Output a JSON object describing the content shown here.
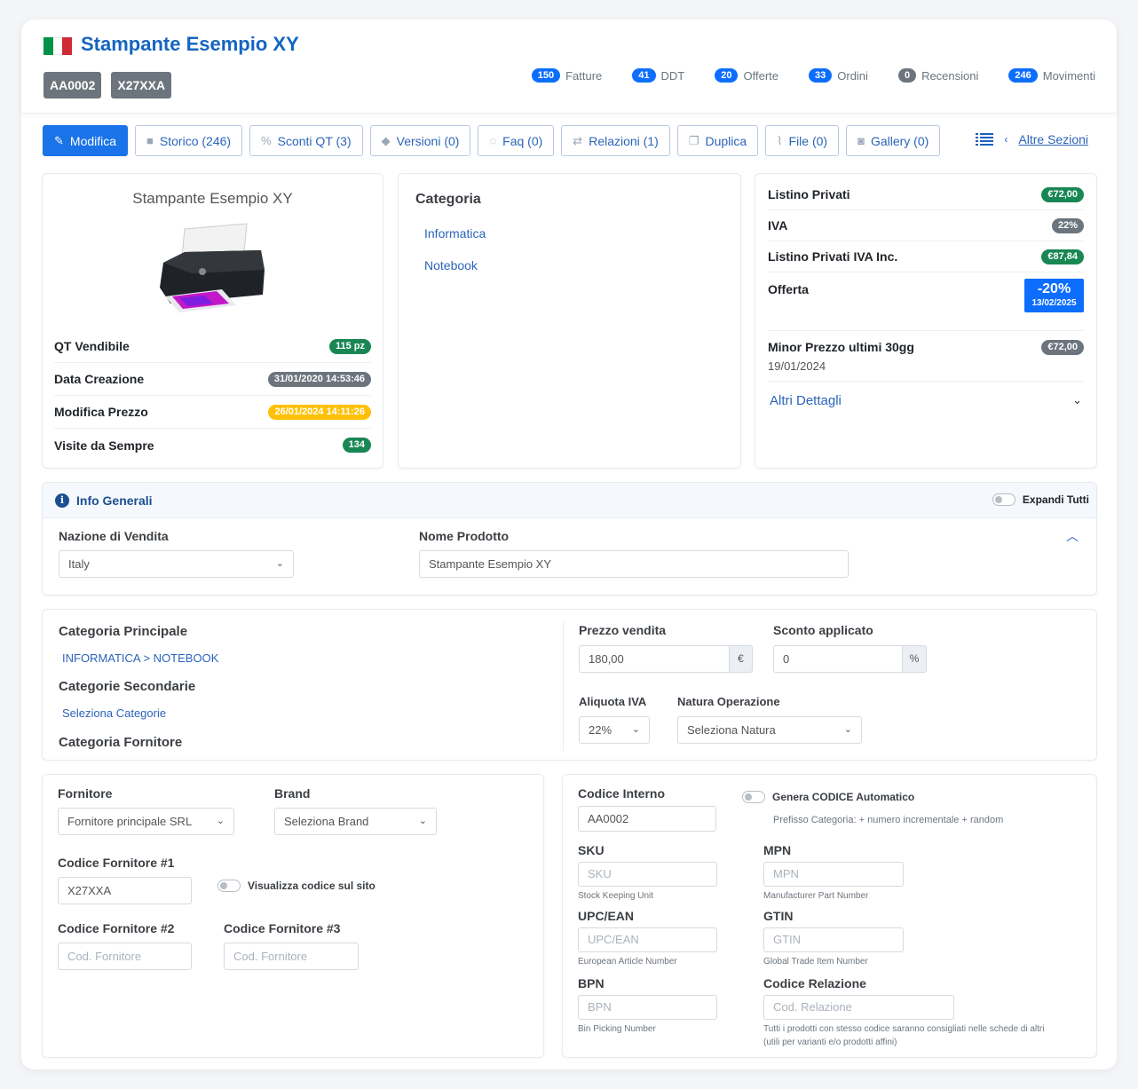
{
  "product": {
    "title": "Stampante Esempio XY",
    "codes": [
      "AA0002",
      "X27XXA"
    ]
  },
  "stats": [
    {
      "count": "150",
      "label": "Fatture",
      "color": "#0d6efd"
    },
    {
      "count": "41",
      "label": "DDT",
      "color": "#0d6efd"
    },
    {
      "count": "20",
      "label": "Offerte",
      "color": "#0d6efd"
    },
    {
      "count": "33",
      "label": "Ordini",
      "color": "#0d6efd"
    },
    {
      "count": "0",
      "label": "Recensioni",
      "color": "#6c757d"
    },
    {
      "count": "246",
      "label": "Movimenti",
      "color": "#0d6efd"
    }
  ],
  "toolbar": {
    "buttons": [
      {
        "label": "Modifica",
        "icon": "pencil-icon"
      },
      {
        "label": "Storico (246)",
        "icon": "history-icon"
      },
      {
        "label": "Sconti QT (3)",
        "icon": "percent-icon"
      },
      {
        "label": "Versioni (0)",
        "icon": "tag-icon"
      },
      {
        "label": "Faq (0)",
        "icon": "chat-icon"
      },
      {
        "label": "Relazioni (1)",
        "icon": "exchange-icon"
      },
      {
        "label": "Duplica",
        "icon": "copy-icon"
      },
      {
        "label": "File (0)",
        "icon": "paperclip-icon"
      },
      {
        "label": "Gallery (0)",
        "icon": "camera-icon"
      }
    ],
    "sections_link": "Altre Sezioni"
  },
  "summary": {
    "name": "Stampante Esempio XY",
    "rows": [
      {
        "label": "QT Vendibile",
        "value": "115 pz"
      },
      {
        "label": "Data Creazione",
        "value": "31/01/2020 14:53:46"
      },
      {
        "label": "Modifica Prezzo",
        "value": "26/01/2024 14:11:26"
      },
      {
        "label": "Visite da Sempre",
        "value": "134"
      }
    ]
  },
  "categoria": {
    "title": "Categoria",
    "items": [
      "Informatica",
      "Notebook"
    ]
  },
  "prices": {
    "listino_label": "Listino Privati",
    "listino_value": "€72,00",
    "iva_label": "IVA",
    "iva_value": "22%",
    "listino_iva_label": "Listino Privati IVA Inc.",
    "listino_iva_value": "€87,84",
    "offerta_label": "Offerta",
    "offerta_percent": "-20%",
    "offerta_date": "13/02/2025",
    "minor_label": "Minor Prezzo ultimi 30gg",
    "minor_date": "19/01/2024",
    "minor_value": "€72,00",
    "altri_dettagli": "Altri Dettagli"
  },
  "info_generali": {
    "title": "Info Generali",
    "expand_label": "Expandi Tutti",
    "nazione_label": "Nazione di Vendita",
    "nazione_value": "Italy",
    "nome_label": "Nome Prodotto",
    "nome_value": "Stampante Esempio XY"
  },
  "categories_panel": {
    "principale_label": "Categoria Principale",
    "principale_value": "INFORMATICA > NOTEBOOK",
    "secondarie_label": "Categorie Secondarie",
    "secondarie_link": "Seleziona Categorie",
    "fornitore_label": "Categoria Fornitore",
    "prezzo_label": "Prezzo vendita",
    "prezzo_value": "180,00",
    "prezzo_unit": "€",
    "sconto_label": "Sconto applicato",
    "sconto_value": "0",
    "sconto_unit": "%",
    "aliquota_label": "Aliquota IVA",
    "aliquota_value": "22%",
    "natura_label": "Natura Operazione",
    "natura_value": "Seleziona Natura"
  },
  "supplier": {
    "fornitore_label": "Fornitore",
    "fornitore_value": "Fornitore principale SRL",
    "brand_label": "Brand",
    "brand_value": "Seleziona Brand",
    "cod1_label": "Codice Fornitore #1",
    "cod1_value": "X27XXA",
    "visualizza_label": "Visualizza codice sul sito",
    "cod2_label": "Codice Fornitore #2",
    "cod2_placeholder": "Cod. Fornitore",
    "cod3_label": "Codice Fornitore #3",
    "cod3_placeholder": "Cod. Fornitore"
  },
  "codes_panel": {
    "interno_label": "Codice Interno",
    "interno_value": "AA0002",
    "genera_label": "Genera CODICE Automatico",
    "genera_hint": "Prefisso Categoria: + numero incrementale + random",
    "sku_label": "SKU",
    "sku_placeholder": "SKU",
    "sku_hint": "Stock Keeping Unit",
    "mpn_label": "MPN",
    "mpn_placeholder": "MPN",
    "mpn_hint": "Manufacturer Part Number",
    "upc_label": "UPC/EAN",
    "upc_placeholder": "UPC/EAN",
    "upc_hint": "European Article Number",
    "gtin_label": "GTIN",
    "gtin_placeholder": "GTIN",
    "gtin_hint": "Global Trade Item Number",
    "bpn_label": "BPN",
    "bpn_placeholder": "BPN",
    "bpn_hint": "Bin Picking Number",
    "rel_label": "Codice Relazione",
    "rel_placeholder": "Cod. Relazione",
    "rel_hint1": "Tutti i prodotti con stesso codice saranno consigliati nelle schede di altri",
    "rel_hint2": "(utili per varianti e/o prodotti affini)"
  }
}
